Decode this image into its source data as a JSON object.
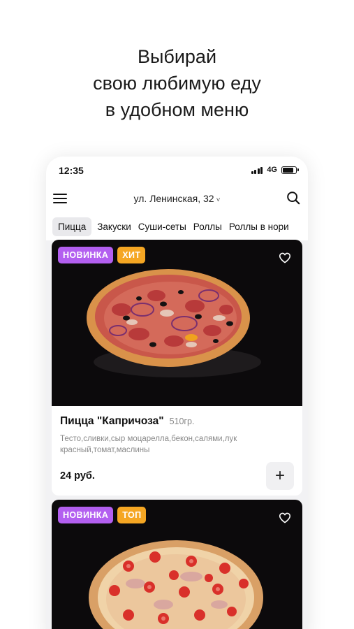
{
  "headline": {
    "line1": "Выбирай",
    "line2": "свою любимую еду",
    "line3": "в удобном меню"
  },
  "statusbar": {
    "time": "12:35",
    "network": "4G",
    "battery_level": 0.85
  },
  "appbar": {
    "address": "ул. Ленинская, 32",
    "address_chevron": "˅",
    "menu_icon": "burger-icon",
    "search_icon": "search-icon"
  },
  "tabs": [
    {
      "label": "Пицца",
      "active": true
    },
    {
      "label": "Закуски",
      "active": false
    },
    {
      "label": "Суши-сеты",
      "active": false
    },
    {
      "label": "Роллы",
      "active": false
    },
    {
      "label": "Роллы в нори",
      "active": false
    }
  ],
  "products": [
    {
      "badges": [
        "НОВИНКА",
        "ХИТ"
      ],
      "name": "Пицца \"Капричоза\"",
      "weight": "510гр.",
      "description": "Тесто,сливки,сыр моцарелла,бекон,салями,лук красный,томат,маслины",
      "price": "24 руб.",
      "add_label": "+"
    },
    {
      "badges": [
        "НОВИНКА",
        "ТОП"
      ]
    }
  ],
  "colors": {
    "badge_new": "#b35ff0",
    "badge_hit": "#f5a623",
    "photo_bg": "#0c0a0c"
  }
}
